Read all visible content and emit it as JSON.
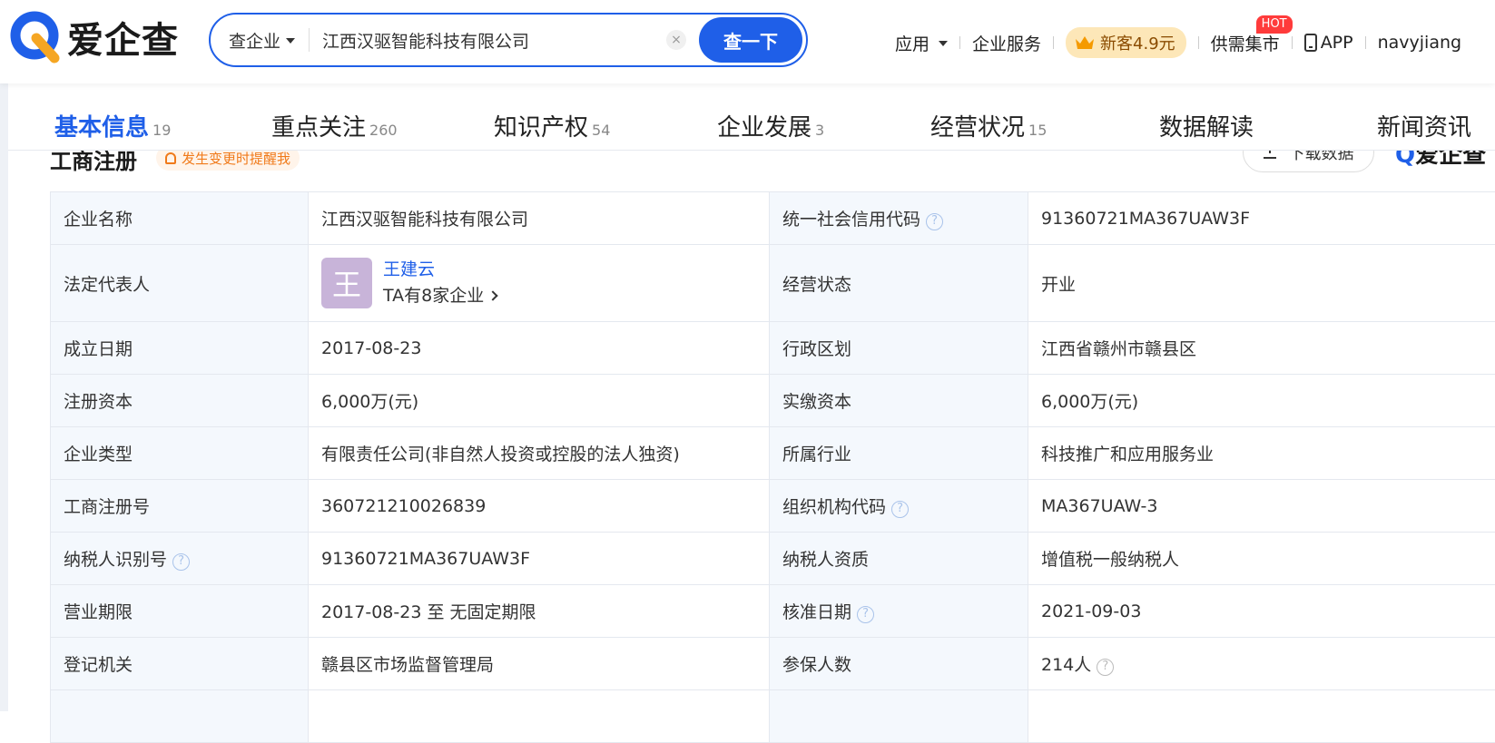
{
  "header": {
    "logo_text": "爱企查",
    "search": {
      "type_label": "查企业",
      "query": "江西汉驱智能科技有限公司",
      "button_label": "查一下",
      "clear_symbol": "×"
    },
    "nav": {
      "apps_label": "应用",
      "enterprise_service_label": "企业服务",
      "promo_label": "新客4.9元",
      "supply_label": "供需集市",
      "hot_badge": "HOT",
      "app_label": "APP",
      "username": "navyjiang"
    }
  },
  "tabs": [
    {
      "label": "基本信息",
      "count": "19"
    },
    {
      "label": "重点关注",
      "count": "260"
    },
    {
      "label": "知识产权",
      "count": "54"
    },
    {
      "label": "企业发展",
      "count": "3"
    },
    {
      "label": "经营状况",
      "count": "15"
    },
    {
      "label": "数据解读",
      "count": ""
    },
    {
      "label": "新闻资讯",
      "count": ""
    }
  ],
  "section": {
    "title": "工商注册",
    "alert_label": "发生变更时提醒我",
    "download_label": "下载数据",
    "mini_logo": "爱企查"
  },
  "info": {
    "company_name_label": "企业名称",
    "company_name": "江西汉驱智能科技有限公司",
    "credit_code_label": "统一社会信用代码",
    "credit_code": "91360721MA367UAW3F",
    "legal_rep_label": "法定代表人",
    "legal_rep_avatar": "王",
    "legal_rep_name": "王建云",
    "legal_rep_sub": "TA有8家企业",
    "status_label": "经营状态",
    "status": "开业",
    "founded_label": "成立日期",
    "founded": "2017-08-23",
    "region_label": "行政区划",
    "region": "江西省赣州市赣县区",
    "reg_capital_label": "注册资本",
    "reg_capital": "6,000万(元)",
    "paid_capital_label": "实缴资本",
    "paid_capital": "6,000万(元)",
    "type_label": "企业类型",
    "type": "有限责任公司(非自然人投资或控股的法人独资)",
    "industry_label": "所属行业",
    "industry": "科技推广和应用服务业",
    "reg_no_label": "工商注册号",
    "reg_no": "360721210026839",
    "org_code_label": "组织机构代码",
    "org_code": "MA367UAW-3",
    "taxpayer_id_label": "纳税人识别号",
    "taxpayer_id": "91360721MA367UAW3F",
    "taxpayer_qual_label": "纳税人资质",
    "taxpayer_qual": "增值税一般纳税人",
    "term_label": "营业期限",
    "term": "2017-08-23 至 无固定期限",
    "approval_label": "核准日期",
    "approval": "2021-09-03",
    "authority_label": "登记机关",
    "authority": "赣县区市场监督管理局",
    "insured_label": "参保人数",
    "insured": "214人"
  },
  "colors": {
    "accent": "#1f5fe8",
    "label_bg": "#f4f8fd",
    "alert": "#f07a1a",
    "hot": "#ff3b3b"
  }
}
